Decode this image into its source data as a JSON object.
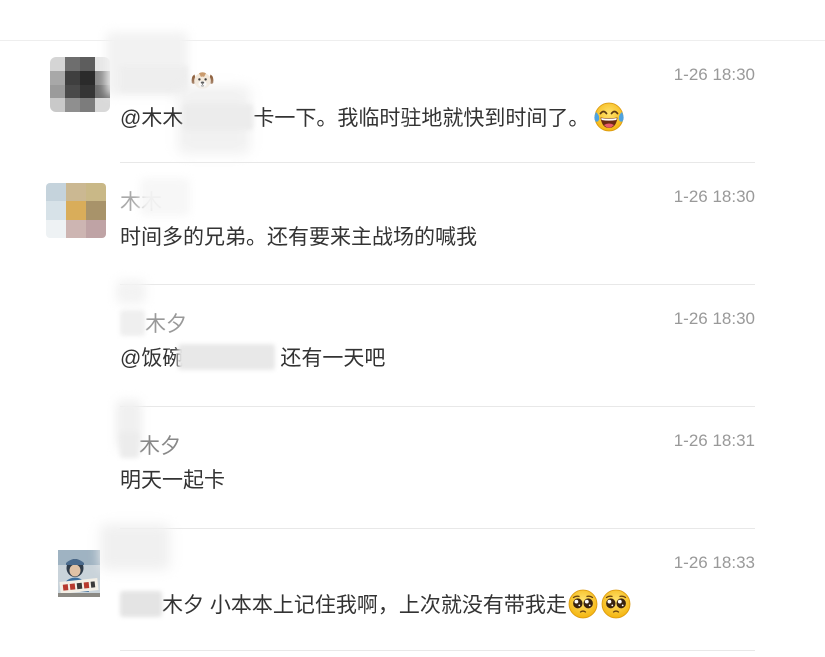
{
  "colors": {
    "text": "#333333",
    "meta": "#999999",
    "divider": "#e8e8e8"
  },
  "comments": [
    {
      "time": "1-26 18:30",
      "mention": "@木木",
      "text": "卡一下。我临时驻地就快到时间了。",
      "name_icon": "dog-face-emoji",
      "text_icons": [
        "face-with-tears-of-joy-emoji"
      ]
    },
    {
      "name": "木木",
      "time": "1-26 18:30",
      "text": "时间多的兄弟。还有要来主战场的喊我"
    },
    {
      "name": "木夕",
      "time": "1-26 18:30",
      "mention": "@饭碗",
      "text": "还有一天吧"
    },
    {
      "name": "木夕",
      "time": "1-26 18:31",
      "text": "明天一起卡"
    },
    {
      "time": "1-26 18:33",
      "text": "木夕 小本本上记住我啊，上次就没有带我走",
      "text_icons": [
        "pleading-face-emoji",
        "pleading-face-emoji"
      ]
    }
  ]
}
